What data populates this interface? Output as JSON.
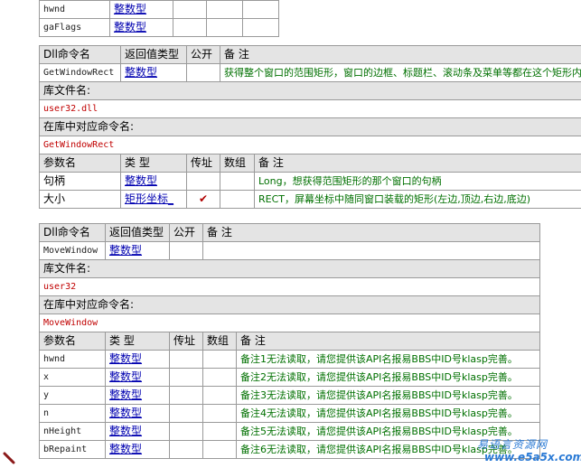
{
  "top_table": {
    "rows": [
      {
        "name": "hwnd",
        "type": "整数型"
      },
      {
        "name": "gaFlags",
        "type": "整数型"
      }
    ]
  },
  "dll1": {
    "header": {
      "cmd": "Dll命令名",
      "ret": "返回值类型",
      "pub": "公开",
      "note": "备 注"
    },
    "cmd_name": "GetWindowRect",
    "ret_type": "整数型",
    "note": "获得整个窗口的范围矩形，窗口的边框、标题栏、滚动条及菜单等都在这个矩形内",
    "lib_label": "库文件名:",
    "lib_value": "user32.dll",
    "alias_label": "在库中对应命令名:",
    "alias_value": "GetWindowRect",
    "param_header": {
      "name": "参数名",
      "type": "类 型",
      "byref": "传址",
      "arr": "数组",
      "note": "备 注"
    },
    "params": [
      {
        "name": "句柄",
        "type": "整数型",
        "byref": "",
        "note": "Long，想获得范围矩形的那个窗口的句柄"
      },
      {
        "name": "大小",
        "type": "矩形坐标_",
        "byref": "✔",
        "note": "RECT，屏幕坐标中随同窗口装载的矩形(左边,顶边,右边,底边)"
      }
    ]
  },
  "dll2": {
    "header": {
      "cmd": "Dll命令名",
      "ret": "返回值类型",
      "pub": "公开",
      "note": "备 注"
    },
    "cmd_name": "MoveWindow",
    "ret_type": "整数型",
    "lib_label": "库文件名:",
    "lib_value": "user32",
    "alias_label": "在库中对应命令名:",
    "alias_value": "MoveWindow",
    "param_header": {
      "name": "参数名",
      "type": "类 型",
      "byref": "传址",
      "arr": "数组",
      "note": "备 注"
    },
    "params": [
      {
        "name": "hwnd",
        "type": "整数型",
        "note": "备注1无法读取，请您提供该API名报易BBS中ID号klasp完善。"
      },
      {
        "name": "x",
        "type": "整数型",
        "note": "备注2无法读取，请您提供该API名报易BBS中ID号klasp完善。"
      },
      {
        "name": "y",
        "type": "整数型",
        "note": "备注3无法读取，请您提供该API名报易BBS中ID号klasp完善。"
      },
      {
        "name": "n",
        "type": "整数型",
        "note": "备注4无法读取，请您提供该API名报易BBS中ID号klasp完善。"
      },
      {
        "name": "nHeight",
        "type": "整数型",
        "note": "备注5无法读取，请您提供该API名报易BBS中ID号klasp完善。"
      },
      {
        "name": "bRepaint",
        "type": "整数型",
        "note": "备注6无法读取，请您提供该API名报易BBS中ID号klasp完善。"
      }
    ]
  },
  "watermark": {
    "line1": "易语言资源网",
    "line2": "www.e5a5x.com"
  },
  "colors": {
    "header_bg": "#e4e4e4",
    "note_green": "#007000",
    "lib_red": "#c00000",
    "link_blue": "#0000b0"
  }
}
